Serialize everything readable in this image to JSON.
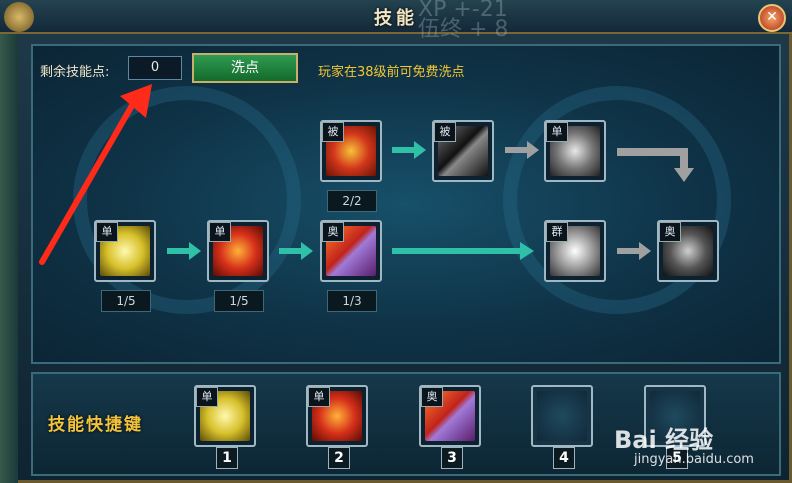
{
  "window": {
    "title": "技能",
    "ghost_text": "XP +-21\n伍终 + 8"
  },
  "points": {
    "label": "剩余技能点:",
    "value": "0"
  },
  "wash_button": {
    "label": "洗点"
  },
  "note": "玩家在38级前可免费洗点",
  "tree": [
    {
      "id": "r1c3",
      "tag": "被",
      "level": "2/2",
      "color": "fire"
    },
    {
      "id": "r1c4",
      "tag": "被",
      "level": "",
      "color": "dark"
    },
    {
      "id": "r1c5",
      "tag": "单",
      "level": "",
      "color": "skull"
    },
    {
      "id": "r2c1",
      "tag": "单",
      "level": "1/5",
      "color": "gold"
    },
    {
      "id": "r2c2",
      "tag": "单",
      "level": "1/5",
      "color": "flame"
    },
    {
      "id": "r2c3",
      "tag": "奥",
      "level": "1/3",
      "color": "spear"
    },
    {
      "id": "r2c5",
      "tag": "群",
      "level": "",
      "color": "white"
    },
    {
      "id": "r2c6",
      "tag": "奥",
      "level": "",
      "color": "grey"
    }
  ],
  "quickbar": {
    "title": "技能快捷键",
    "slots": [
      {
        "num": "1",
        "tag": "单",
        "color": "gold"
      },
      {
        "num": "2",
        "tag": "单",
        "color": "flame"
      },
      {
        "num": "3",
        "tag": "奥",
        "color": "spear"
      },
      {
        "num": "4",
        "tag": "",
        "color": "empty"
      },
      {
        "num": "5",
        "tag": "",
        "color": "empty"
      }
    ]
  },
  "watermark": {
    "brand": "Bai 经验",
    "url": "jingyan.baidu.com"
  },
  "colors": {
    "gold_text": "#f2c33c",
    "note": "#f3c733",
    "arrow_teal": "#2fc1a8",
    "arrow_grey": "#a0a0a0",
    "close_red": "#b02a12"
  }
}
